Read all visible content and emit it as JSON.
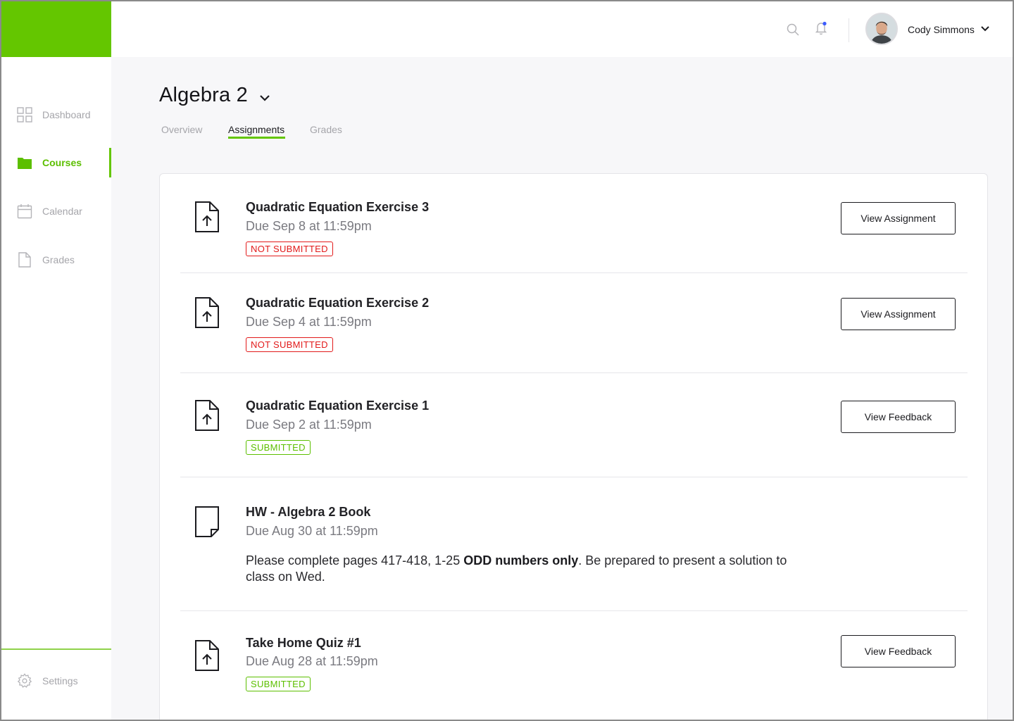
{
  "user": {
    "name": "Cody Simmons"
  },
  "sidebar": {
    "items": [
      {
        "label": "Dashboard",
        "icon": "grid-icon",
        "active": false
      },
      {
        "label": "Courses",
        "icon": "folder-icon",
        "active": true
      },
      {
        "label": "Calendar",
        "icon": "calendar-icon",
        "active": false
      },
      {
        "label": "Grades",
        "icon": "document-icon",
        "active": false
      }
    ],
    "settings_label": "Settings"
  },
  "course": {
    "title": "Algebra 2",
    "tabs": [
      {
        "label": "Overview",
        "active": false
      },
      {
        "label": "Assignments",
        "active": true
      },
      {
        "label": "Grades",
        "active": false
      }
    ]
  },
  "assignments": [
    {
      "title": "Quadratic Equation Exercise 3",
      "due": "Due Sep 8 at 11:59pm",
      "status": "NOT SUBMITTED",
      "button": "View Assignment",
      "icon": "file-upload-icon"
    },
    {
      "title": "Quadratic Equation Exercise 2",
      "due": "Due Sep 4 at 11:59pm",
      "status": "NOT SUBMITTED",
      "button": "View Assignment",
      "icon": "file-upload-icon"
    },
    {
      "title": "Quadratic Equation Exercise 1",
      "due": "Due Sep 2 at 11:59pm",
      "status": "SUBMITTED",
      "button": "View Feedback",
      "icon": "file-upload-icon"
    },
    {
      "title": "HW - Algebra 2 Book",
      "due": "Due Aug 30 at 11:59pm",
      "icon": "blank-page-icon",
      "desc_pre": "Please complete pages 417-418, 1-25 ",
      "desc_bold": "ODD numbers only",
      "desc_post": ". Be prepared to present a solution to class on Wed."
    },
    {
      "title": "Take Home Quiz #1",
      "due": "Due Aug 28 at 11:59pm",
      "status": "SUBMITTED",
      "button": "View Feedback",
      "icon": "file-upload-icon"
    }
  ],
  "colors": {
    "accent": "#64c600",
    "not_submitted": "#e21a1a",
    "notification_dot": "#3b5bff"
  }
}
